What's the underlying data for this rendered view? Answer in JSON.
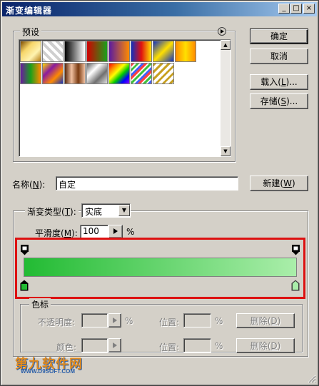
{
  "window": {
    "title": "渐变编辑器",
    "controls": [
      "_",
      "□",
      "×"
    ]
  },
  "buttons": {
    "ok": "确定",
    "cancel": "取消",
    "load_pre": "载入(",
    "load_key": "L",
    "load_post": ")...",
    "save_pre": "存储(",
    "save_key": "S",
    "save_post": ")...",
    "new_pre": "新建(",
    "new_key": "W",
    "new_post": ")",
    "delete1_pre": "删除(",
    "delete1_key": "D",
    "delete1_post": ")",
    "delete2_pre": "删除(",
    "delete2_key": "D",
    "delete2_post": ")"
  },
  "presets": {
    "label": "预设",
    "menu_icon": "arrow-right-circle-icon",
    "swatches": [
      {
        "name": "copper-gold"
      },
      {
        "name": "transparent-stripes"
      },
      {
        "name": "black-white"
      },
      {
        "name": "red-green"
      },
      {
        "name": "violet-orange"
      },
      {
        "name": "blue-red-yellow"
      },
      {
        "name": "blue-yellow-blue"
      },
      {
        "name": "orange-yellow-orange"
      },
      {
        "name": "violet-green-orange"
      },
      {
        "name": "yellow-violet-orange-blue"
      },
      {
        "name": "copper"
      },
      {
        "name": "chrome"
      },
      {
        "name": "spectrum"
      },
      {
        "name": "transparent-rainbow"
      },
      {
        "name": "transparent-stripes-gold"
      }
    ]
  },
  "name_field": {
    "label_pre": "名称(",
    "label_key": "N",
    "label_post": "):",
    "value": "自定"
  },
  "gradient": {
    "type_label_pre": "渐变类型(",
    "type_label_key": "T",
    "type_label_post": "):",
    "type_value": "实底",
    "smoothness_label_pre": "平滑度(",
    "smoothness_label_key": "M",
    "smoothness_label_post": "):",
    "smoothness_value": "100",
    "smoothness_unit": "%",
    "start_color": "#22bb33",
    "end_color": "#aaeeaa",
    "highlight_color": "#dd1111"
  },
  "stops": {
    "group_label": "色标",
    "opacity_label": "不透明度:",
    "opacity_unit": "%",
    "position_label_1": "位置:",
    "position_unit_1": "%",
    "color_label": "颜色:",
    "position_label_2": "位置:",
    "position_unit_2": "%"
  },
  "watermark": {
    "text_main": "第九软件网",
    "text_sub": "WWW.D9SOFT.COM"
  }
}
